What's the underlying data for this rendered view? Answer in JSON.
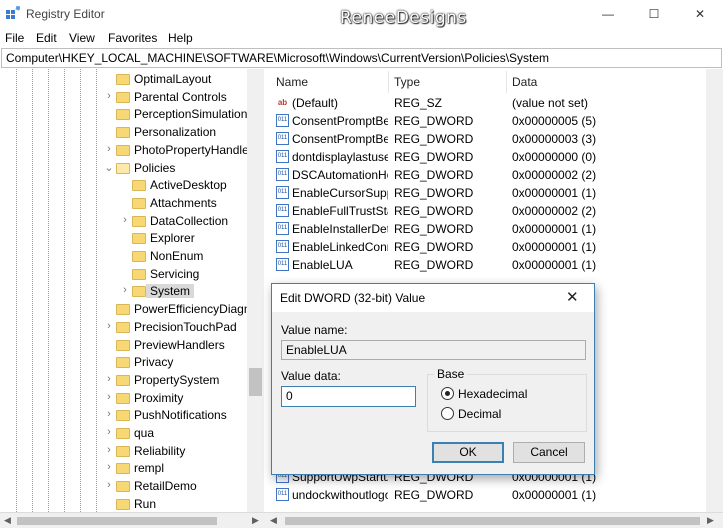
{
  "window": {
    "title": "Registry Editor",
    "watermark": "ReneeDesigns",
    "minimize_glyph": "—",
    "maximize_glyph": "☐",
    "close_glyph": "✕"
  },
  "menu": [
    "File",
    "Edit",
    "View",
    "Favorites",
    "Help"
  ],
  "address": "Computer\\HKEY_LOCAL_MACHINE\\SOFTWARE\\Microsoft\\Windows\\CurrentVersion\\Policies\\System",
  "tree": {
    "items": [
      {
        "label": "OptimalLayout",
        "depth": 0,
        "chevron": ""
      },
      {
        "label": "Parental Controls",
        "depth": 0,
        "chevron": "›"
      },
      {
        "label": "PerceptionSimulation",
        "depth": 0,
        "chevron": ""
      },
      {
        "label": "Personalization",
        "depth": 0,
        "chevron": ""
      },
      {
        "label": "PhotoPropertyHandle",
        "depth": 0,
        "chevron": "›"
      },
      {
        "label": "Policies",
        "depth": 0,
        "chevron": "⌄",
        "open": true
      },
      {
        "label": "ActiveDesktop",
        "depth": 1,
        "chevron": ""
      },
      {
        "label": "Attachments",
        "depth": 1,
        "chevron": ""
      },
      {
        "label": "DataCollection",
        "depth": 1,
        "chevron": "›"
      },
      {
        "label": "Explorer",
        "depth": 1,
        "chevron": ""
      },
      {
        "label": "NonEnum",
        "depth": 1,
        "chevron": ""
      },
      {
        "label": "Servicing",
        "depth": 1,
        "chevron": ""
      },
      {
        "label": "System",
        "depth": 1,
        "chevron": "›",
        "selected": true
      },
      {
        "label": "PowerEfficiencyDiagn",
        "depth": 0,
        "chevron": ""
      },
      {
        "label": "PrecisionTouchPad",
        "depth": 0,
        "chevron": "›"
      },
      {
        "label": "PreviewHandlers",
        "depth": 0,
        "chevron": ""
      },
      {
        "label": "Privacy",
        "depth": 0,
        "chevron": ""
      },
      {
        "label": "PropertySystem",
        "depth": 0,
        "chevron": "›"
      },
      {
        "label": "Proximity",
        "depth": 0,
        "chevron": "›"
      },
      {
        "label": "PushNotifications",
        "depth": 0,
        "chevron": "›"
      },
      {
        "label": "qua",
        "depth": 0,
        "chevron": "›"
      },
      {
        "label": "Reliability",
        "depth": 0,
        "chevron": "›"
      },
      {
        "label": "rempl",
        "depth": 0,
        "chevron": "›"
      },
      {
        "label": "RetailDemo",
        "depth": 0,
        "chevron": "›"
      },
      {
        "label": "Run",
        "depth": 0,
        "chevron": ""
      }
    ]
  },
  "list": {
    "columns": [
      "Name",
      "Type",
      "Data"
    ],
    "rows": [
      {
        "icon": "string-value-icon",
        "name": "(Default)",
        "type": "REG_SZ",
        "data": "(value not set)"
      },
      {
        "icon": "dword-value-icon",
        "name": "ConsentPromptBehaviorAdmin",
        "type": "REG_DWORD",
        "data": "0x00000005 (5)"
      },
      {
        "icon": "dword-value-icon",
        "name": "ConsentPromptBehaviorUser",
        "type": "REG_DWORD",
        "data": "0x00000003 (3)"
      },
      {
        "icon": "dword-value-icon",
        "name": "dontdisplaylastusername",
        "type": "REG_DWORD",
        "data": "0x00000000 (0)"
      },
      {
        "icon": "dword-value-icon",
        "name": "DSCAutomationHostEnabled",
        "type": "REG_DWORD",
        "data": "0x00000002 (2)"
      },
      {
        "icon": "dword-value-icon",
        "name": "EnableCursorSuppression",
        "type": "REG_DWORD",
        "data": "0x00000001 (1)"
      },
      {
        "icon": "dword-value-icon",
        "name": "EnableFullTrustStartupTasks",
        "type": "REG_DWORD",
        "data": "0x00000002 (2)"
      },
      {
        "icon": "dword-value-icon",
        "name": "EnableInstallerDetection",
        "type": "REG_DWORD",
        "data": "0x00000001 (1)"
      },
      {
        "icon": "dword-value-icon",
        "name": "EnableLinkedConnections",
        "type": "REG_DWORD",
        "data": "0x00000001 (1)"
      },
      {
        "icon": "dword-value-icon",
        "name": "EnableLUA",
        "type": "REG_DWORD",
        "data": "0x00000001 (1)"
      },
      {
        "icon": "dword-value-icon",
        "name": "SupportUwpStartupTasks",
        "type": "REG_DWORD",
        "data": "0x00000001 (1)"
      },
      {
        "icon": "dword-value-icon",
        "name": "undockwithoutlogon",
        "type": "REG_DWORD",
        "data": "0x00000001 (1)"
      }
    ]
  },
  "dialog": {
    "title": "Edit DWORD (32-bit) Value",
    "close_glyph": "✕",
    "value_name_label": "Value name:",
    "value_name": "EnableLUA",
    "value_data_label": "Value data:",
    "value_data": "0",
    "base_label": "Base",
    "radio_hex": "Hexadecimal",
    "radio_dec": "Decimal",
    "selected_base": "Hexadecimal",
    "ok": "OK",
    "cancel": "Cancel"
  }
}
